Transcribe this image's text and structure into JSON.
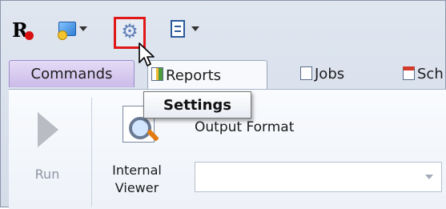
{
  "toolbar": {
    "logo_icon": "r-logo-icon",
    "buttons": [
      {
        "icon": "data-source-icon",
        "has_dropdown": true
      },
      {
        "icon": "gear-icon",
        "highlighted": true,
        "highlight_color": "#e01818"
      },
      {
        "icon": "list-view-icon",
        "has_dropdown": true
      }
    ]
  },
  "tabs": [
    {
      "label": "Commands",
      "state": "hover"
    },
    {
      "label": "Reports",
      "state": "selected",
      "icon": "report-icon"
    },
    {
      "label": "Jobs",
      "icon": "jobs-icon"
    },
    {
      "label": "Sch",
      "icon": "calendar-icon"
    }
  ],
  "tooltip": {
    "text": "Settings"
  },
  "ribbon": {
    "run": {
      "label": "Run",
      "enabled": false
    },
    "internal_viewer": {
      "label_line1": "Internal",
      "label_line2": "Viewer"
    },
    "output_format": {
      "label": "Output Format",
      "value": ""
    }
  },
  "colors": {
    "accent": "#e01818",
    "tab_hover": "#cbbbe9"
  }
}
